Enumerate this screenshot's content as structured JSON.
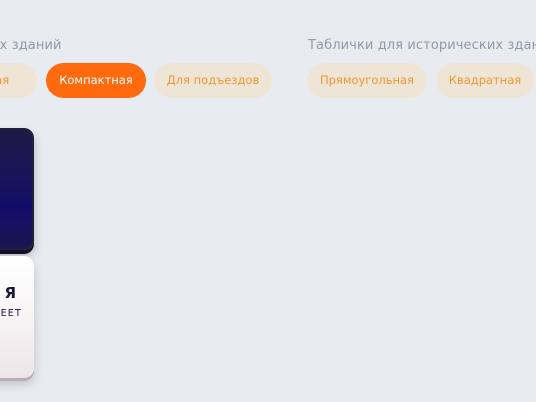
{
  "groups": [
    {
      "title": "еменных зданий",
      "options": [
        {
          "label": "лая",
          "active": false
        },
        {
          "label": "Компактная",
          "active": true
        },
        {
          "label": "Для подъездов",
          "active": false
        }
      ]
    },
    {
      "title": "Таблички для исторических зданий",
      "options": [
        {
          "label": "Прямоугольная",
          "active": false
        },
        {
          "label": "Квадратная",
          "active": false
        }
      ]
    }
  ],
  "plate_preview": {
    "main_text": "Я",
    "sub_text": "REET"
  },
  "colors": {
    "background": "#e8ecf0",
    "pill_inactive_bg": "#efe5d6",
    "pill_inactive_text": "#e79a2f",
    "pill_active_bg": "#ff6a0f",
    "pill_active_text": "#ffffff",
    "title_text": "#8f99a8",
    "plate_dark": "#17135a"
  }
}
